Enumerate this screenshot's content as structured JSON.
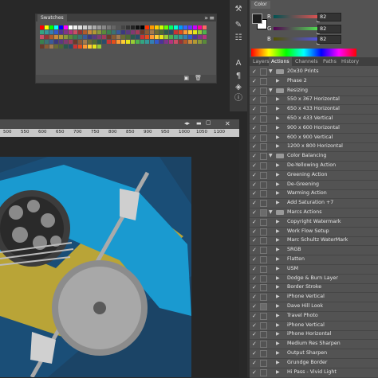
{
  "swatches_panel": {
    "tab": "Swatches"
  },
  "color_panel": {
    "tab": "Color",
    "channels": [
      {
        "label": "R",
        "value": "82"
      },
      {
        "label": "G",
        "value": "82"
      },
      {
        "label": "B",
        "value": "82"
      }
    ]
  },
  "actions_panel": {
    "tabs": [
      "Layers",
      "Actions",
      "Channels",
      "Paths",
      "History"
    ],
    "active_tab": "Actions",
    "rows": [
      {
        "type": "set",
        "label": "20x30 Prints",
        "mbox": false
      },
      {
        "type": "action",
        "label": "Phase 2",
        "mbox": false
      },
      {
        "type": "set",
        "label": "Resizing",
        "mbox": false
      },
      {
        "type": "action",
        "label": "550 x 367 Horizontal",
        "mbox": false
      },
      {
        "type": "action",
        "label": "650 x 433 Horizontal",
        "mbox": false
      },
      {
        "type": "action",
        "label": "650 x 433 Vertical",
        "mbox": false
      },
      {
        "type": "action",
        "label": "900 x 600 Horizontal",
        "mbox": false
      },
      {
        "type": "action",
        "label": "600 x 900 Vertical",
        "mbox": false
      },
      {
        "type": "action",
        "label": "1200 x 800 Horizontal",
        "mbox": false
      },
      {
        "type": "set",
        "label": "Color Balancing",
        "mbox": false
      },
      {
        "type": "action",
        "label": "De-Yellowing Action",
        "mbox": false
      },
      {
        "type": "action",
        "label": "Greening Action",
        "mbox": false
      },
      {
        "type": "action",
        "label": "De-Greening",
        "mbox": false
      },
      {
        "type": "action",
        "label": "Warming Action",
        "mbox": false
      },
      {
        "type": "action",
        "label": "Add Saturation +7",
        "mbox": false
      },
      {
        "type": "set",
        "label": "Marcs Actions",
        "mbox": true
      },
      {
        "type": "action",
        "label": "Copyright Watermark",
        "mbox": false
      },
      {
        "type": "action",
        "label": "Work Flow Setup",
        "mbox": false
      },
      {
        "type": "action",
        "label": "Marc Schultz WaterMark",
        "mbox": false
      },
      {
        "type": "action",
        "label": "SRGB",
        "mbox": false
      },
      {
        "type": "action",
        "label": "Flatten",
        "mbox": false
      },
      {
        "type": "action",
        "label": "USM",
        "mbox": false
      },
      {
        "type": "action",
        "label": "Dodge & Burn Layer",
        "mbox": false
      },
      {
        "type": "action",
        "label": "Border Stroke",
        "mbox": false
      },
      {
        "type": "action",
        "label": "iPhone Vertical",
        "mbox": false
      },
      {
        "type": "action",
        "label": "Dave Hill Look",
        "mbox": true
      },
      {
        "type": "action",
        "label": "Travel Photo",
        "mbox": false
      },
      {
        "type": "action",
        "label": "iPhone Vertical",
        "mbox": false
      },
      {
        "type": "action",
        "label": "iPhone Horizontal",
        "mbox": false
      },
      {
        "type": "action",
        "label": "Medium Res Sharpen",
        "mbox": false
      },
      {
        "type": "action",
        "label": "Output Sharpen",
        "mbox": false
      },
      {
        "type": "action",
        "label": "Grundge Border",
        "mbox": false
      },
      {
        "type": "action",
        "label": "Hi Pass - Vivid Light",
        "mbox": false
      }
    ]
  },
  "document": {
    "ruler_ticks": [
      "500",
      "550",
      "600",
      "650",
      "700",
      "750",
      "800",
      "850",
      "900",
      "950",
      "1000",
      "1050",
      "1100"
    ]
  },
  "colors": {
    "foreground": "#1e1e1e",
    "background": "#ffffff",
    "artwork_blue": "#1a3f62"
  }
}
